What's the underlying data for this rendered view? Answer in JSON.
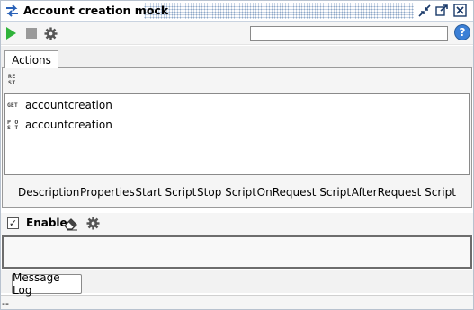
{
  "window": {
    "title": "Account creation mock"
  },
  "toolbar": {
    "search_value": "",
    "help_glyph": "?"
  },
  "tabs": [
    {
      "label": "Actions"
    }
  ],
  "actions": {
    "items": [
      {
        "method": "GET",
        "label": "accountcreation"
      },
      {
        "method": "POST",
        "label": "accountcreation"
      }
    ],
    "detail_tabs": [
      "Description",
      "Properties",
      "Start Script",
      "Stop Script",
      "OnRequest Script",
      "AfterRequest Script"
    ]
  },
  "enable": {
    "label": "Enable",
    "checked": true
  },
  "log": {
    "tab_label": "Message Log"
  },
  "status": {
    "text": "--"
  },
  "colors": {
    "accent": "#3b7fd6",
    "run_green": "#2fb33a",
    "title_dots": "#8fa8c8"
  },
  "icons": {
    "title": "mock-service-icon",
    "run": "play-icon",
    "stop": "stop-icon",
    "options": "gear-icon",
    "help": "help-icon",
    "minimize": "restore-icon",
    "maximize": "maximize-icon",
    "close": "close-icon",
    "clear": "eraser-icon",
    "settings": "gear-icon"
  }
}
